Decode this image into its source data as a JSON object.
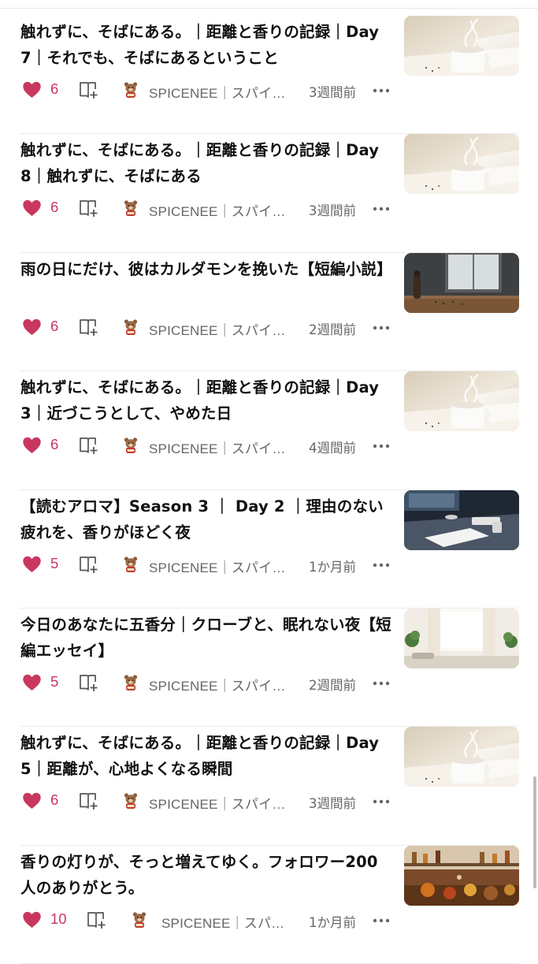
{
  "articles": [
    {
      "title": "触れずに、そばにある。｜距離と香りの記録｜Day 7｜それでも、そばにあるということ",
      "likes": "6",
      "author": "SPICENEE｜スパイ…",
      "time": "3週間前",
      "thumb": "steaming-cup"
    },
    {
      "title": "触れずに、そばにある。｜距離と香りの記録｜Day 8｜触れずに、そばにある",
      "likes": "6",
      "author": "SPICENEE｜スパイ…",
      "time": "3週間前",
      "thumb": "steaming-cup"
    },
    {
      "title": "雨の日にだけ、彼はカルダモンを挽いた【短編小説】",
      "likes": "6",
      "author": "SPICENEE｜スパイ…",
      "time": "2週間前",
      "thumb": "rainy-window"
    },
    {
      "title": "触れずに、そばにある。｜距離と香りの記録｜Day 3｜近づこうとして、やめた日",
      "likes": "6",
      "author": "SPICENEE｜スパイ…",
      "time": "4週間前",
      "thumb": "steaming-cup"
    },
    {
      "title": "【読むアロマ】Season 3 ｜ Day 2 ｜理由のない疲れを、香りがほどく夜",
      "likes": "5",
      "author": "SPICENEE｜スパイ…",
      "time": "1か月前",
      "thumb": "desk-night"
    },
    {
      "title": "今日のあなたに五香分｜クローブと、眠れない夜【短編エッセイ】",
      "likes": "5",
      "author": "SPICENEE｜スパイ…",
      "time": "2週間前",
      "thumb": "sunny-room"
    },
    {
      "title": "触れずに、そばにある。｜距離と香りの記録｜Day 5｜距離が、心地よくなる瞬間",
      "likes": "6",
      "author": "SPICENEE｜スパイ…",
      "time": "3週間前",
      "thumb": "steaming-cup"
    },
    {
      "title": "香りの灯りが、そっと増えてゆく。フォロワー200人のありがとう。",
      "likes": "10",
      "author": "SPICENEE｜スパ…",
      "time": "1か月前",
      "thumb": "spice-kitchen"
    }
  ],
  "colors": {
    "like": "#c9375f",
    "meta": "#666666",
    "divider": "#ececec"
  },
  "icons": {
    "like": "heart-icon",
    "magazine": "add-to-magazine-icon",
    "more": "more-icon",
    "avatar": "bear-avatar"
  }
}
